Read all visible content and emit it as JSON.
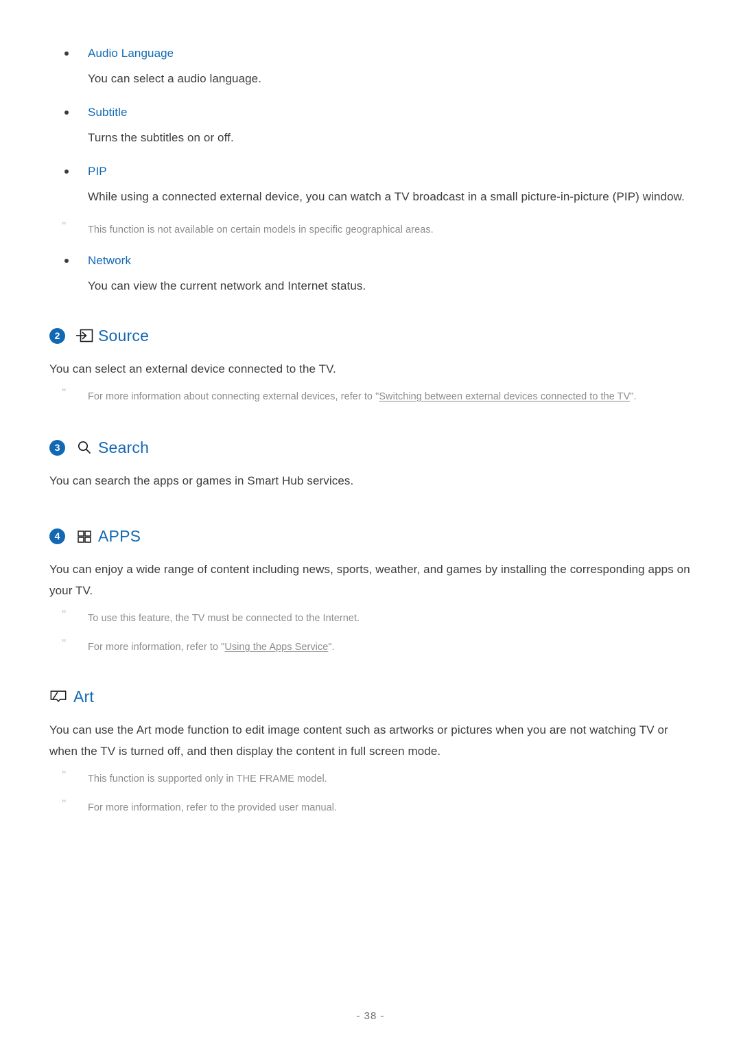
{
  "options": [
    {
      "icon": "bullet-icon",
      "title": "Audio Language",
      "desc": "You can select a audio language."
    },
    {
      "icon": "bullet-icon",
      "title": "Subtitle",
      "desc": "Turns the subtitles on or off."
    },
    {
      "icon": "bullet-icon",
      "title": "PIP",
      "desc": "While using a connected external device, you can watch a TV broadcast in a small picture-in-picture (PIP) window.",
      "note": "This function is not available on certain models in specific geographical areas."
    },
    {
      "icon": "bullet-icon",
      "title": "Network",
      "desc": "You can view the current network and Internet status."
    }
  ],
  "sections": [
    {
      "number": "2",
      "icon": "source-input-icon",
      "title": "Source",
      "body": "You can select an external device connected to the TV.",
      "notes": [
        {
          "prefix": "For more information about connecting external devices, refer to \"",
          "link": "Switching between external devices connected to the TV",
          "suffix": "\"."
        }
      ]
    },
    {
      "number": "3",
      "icon": "search-icon",
      "title": "Search",
      "body": "You can search the apps or games in Smart Hub services.",
      "notes": []
    },
    {
      "number": "4",
      "icon": "apps-grid-icon",
      "title": "APPS",
      "body": "You can enjoy a wide range of content including news, sports, weather, and games by installing the corresponding apps on your TV.",
      "notes": [
        {
          "prefix": "To use this feature, the TV must be connected to the Internet.",
          "link": "",
          "suffix": ""
        },
        {
          "prefix": "For more information, refer to \"",
          "link": "Using the Apps Service",
          "suffix": "\"."
        }
      ]
    },
    {
      "number": "",
      "icon": "art-frame-icon",
      "title": "Art",
      "body": "You can use the Art mode function to edit image content such as artworks or pictures when you are not watching TV or when the TV is turned off, and then display the content in full screen mode.",
      "notes": [
        {
          "prefix": "This function is supported only in THE FRAME model.",
          "link": "",
          "suffix": ""
        },
        {
          "prefix": "For more information, refer to the provided user manual.",
          "link": "",
          "suffix": ""
        }
      ]
    }
  ],
  "note_marker": "\"",
  "footer": {
    "page_label": "- 38 -"
  },
  "colors": {
    "accent": "#1268b3",
    "body_text": "#3c3c3c",
    "note_text": "#8c8c8c"
  }
}
